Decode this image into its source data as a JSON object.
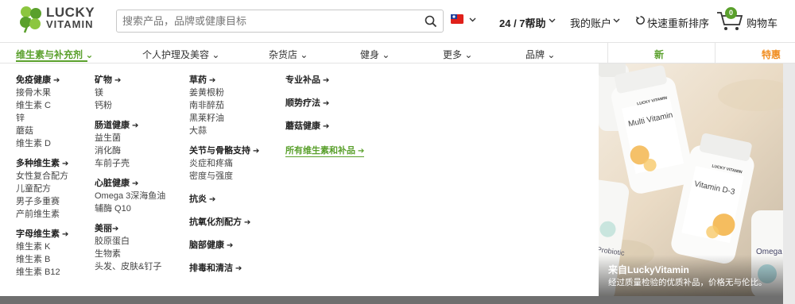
{
  "brand": {
    "logo_line1": "LUCKY",
    "logo_line2": "VITAMIN",
    "green": "#5aa02c",
    "orange": "#f08c1e"
  },
  "header": {
    "search_placeholder": "搜索产品，品牌或健康目标",
    "search_icon": "search-icon",
    "flag_icon": "taiwan-flag-icon",
    "help_label": "24 / 7帮助",
    "account_label": "我的账户",
    "reorder_label": "快速重新排序",
    "cart_label": "购物车",
    "cart_count": "0"
  },
  "nav": {
    "items": [
      {
        "label": "维生素与补充剂"
      },
      {
        "label": "个人护理及美容"
      },
      {
        "label": "杂货店"
      },
      {
        "label": "健身"
      },
      {
        "label": "更多"
      },
      {
        "label": "品牌"
      }
    ],
    "new_label": "新",
    "sale_label": "特惠"
  },
  "menu": {
    "col1": [
      {
        "title": "免疫健康",
        "items": [
          "接骨木果",
          "维生素 C",
          "锌",
          "蘑菇",
          "维生素 D"
        ]
      },
      {
        "title": "多种维生素",
        "items": [
          "女性复合配方",
          "儿童配方",
          "男子多重赛",
          "产前维生素"
        ]
      },
      {
        "title": "字母维生素",
        "items": [
          "维生素 K",
          "维生素 B",
          "维生素 B12"
        ]
      }
    ],
    "col2": [
      {
        "title": "矿物",
        "items": [
          "镁",
          "钙粉"
        ]
      },
      {
        "title": "肠道健康",
        "items": [
          "益生菌",
          "消化酶",
          "车前子壳"
        ]
      },
      {
        "title": "心脏健康",
        "items": [
          "Omega 3深海鱼油",
          "辅酶 Q10"
        ]
      },
      {
        "title": "美丽",
        "items": [
          "胶原蛋白",
          "生物素",
          "头发、皮肤&钉子"
        ]
      }
    ],
    "col3": [
      {
        "title": "草药",
        "items": [
          "姜黄根粉",
          "南非醉茄",
          "黑莱籽油",
          "大蒜"
        ]
      },
      {
        "title": "关节与骨骼支持",
        "items": [
          "炎症和疼痛",
          "密度与强度"
        ]
      },
      {
        "title": "抗炎",
        "items": []
      },
      {
        "title": "抗氧化剂配方",
        "items": []
      },
      {
        "title": "脑部健康",
        "items": []
      },
      {
        "title": "排毒和清洁",
        "items": []
      }
    ],
    "col4": [
      {
        "title": "专业补品"
      },
      {
        "title": "顺势疗法"
      },
      {
        "title": "蘑菇健康"
      }
    ],
    "all_link": "所有维生素和补品"
  },
  "promo": {
    "title": "来自LuckyVitamin",
    "subtitle": "经过质量检验的优质补品，价格无与伦比。",
    "bottle1": {
      "brand": "LUCKY VITAMIN",
      "name": "Multi Vitamin"
    },
    "bottle2": {
      "brand": "LUCKY VITAMIN",
      "name": "Vitamin D-3"
    },
    "bottle3": {
      "name": "Omega Fish Oil"
    },
    "bottle4": {
      "name": "Probiotic"
    }
  }
}
